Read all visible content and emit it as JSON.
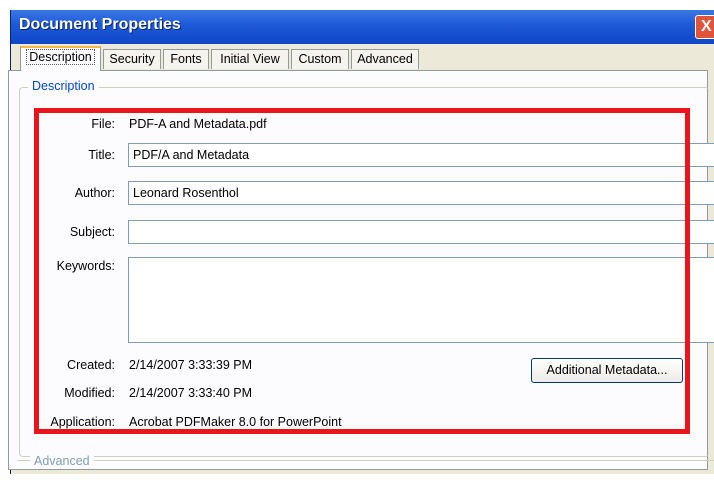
{
  "window": {
    "title": "Document Properties",
    "close_glyph": "X"
  },
  "tabs": [
    {
      "label": "Description",
      "active": true
    },
    {
      "label": "Security",
      "active": false
    },
    {
      "label": "Fonts",
      "active": false
    },
    {
      "label": "Initial View",
      "active": false
    },
    {
      "label": "Custom",
      "active": false
    },
    {
      "label": "Advanced",
      "active": false
    }
  ],
  "description_group": {
    "legend": "Description",
    "file_label": "File:",
    "file_value": "PDF-A and Metadata.pdf",
    "title_label": "Title:",
    "title_value": "PDF/A and Metadata",
    "author_label": "Author:",
    "author_value": "Leonard Rosenthol",
    "subject_label": "Subject:",
    "subject_value": "",
    "keywords_label": "Keywords:",
    "keywords_value": "",
    "created_label": "Created:",
    "created_value": "2/14/2007 3:33:39 PM",
    "modified_label": "Modified:",
    "modified_value": "2/14/2007 3:33:40 PM",
    "application_label": "Application:",
    "application_value": "Acrobat PDFMaker 8.0 for PowerPoint",
    "metadata_button_label": "Additional Metadata..."
  },
  "advanced_group": {
    "legend": "Advanced"
  },
  "colors": {
    "titlebar": "#1f5bd8",
    "highlight": "#e8161b",
    "legend_text": "#0046d5"
  }
}
